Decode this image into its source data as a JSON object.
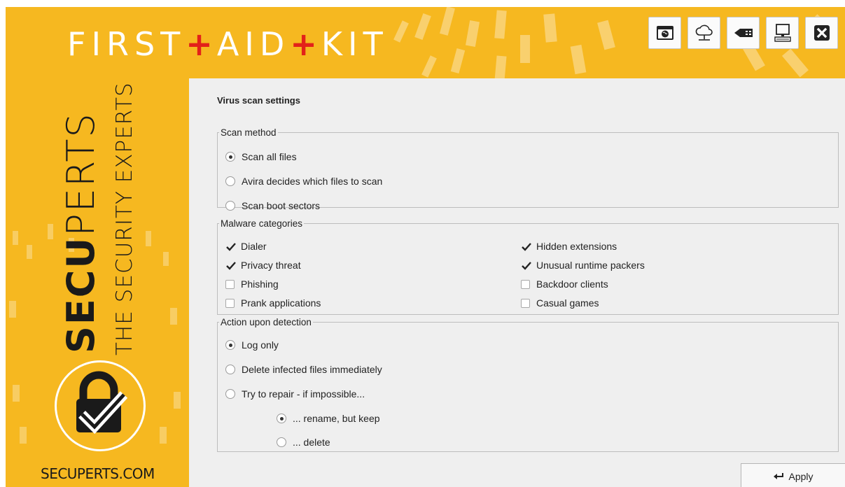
{
  "app": {
    "title_parts": [
      "FIRST",
      "AID",
      "KIT"
    ],
    "title_separator": "+"
  },
  "toolbar": {
    "buttons": [
      {
        "name": "browser-icon"
      },
      {
        "name": "cloud-network-icon"
      },
      {
        "name": "usb-icon"
      },
      {
        "name": "computer-icon"
      },
      {
        "name": "close-icon"
      }
    ]
  },
  "brand": {
    "name_bold": "SECU",
    "name_thin": "PERTS",
    "tagline": "THE SECURITY EXPERTS",
    "url": "SECUPERTS.COM"
  },
  "page": {
    "title": "Virus scan settings"
  },
  "scan_method": {
    "legend": "Scan method",
    "options": [
      {
        "label": "Scan all files",
        "selected": true
      },
      {
        "label": "Avira decides which files to scan",
        "selected": false
      },
      {
        "label": "Scan boot sectors",
        "selected": false
      }
    ]
  },
  "malware": {
    "legend": "Malware categories",
    "left": [
      {
        "label": "Dialer",
        "checked": true
      },
      {
        "label": "Privacy threat",
        "checked": true
      },
      {
        "label": "Phishing",
        "checked": false
      },
      {
        "label": "Prank applications",
        "checked": false
      }
    ],
    "right": [
      {
        "label": "Hidden extensions",
        "checked": true
      },
      {
        "label": "Unusual runtime packers",
        "checked": true
      },
      {
        "label": "Backdoor clients",
        "checked": false
      },
      {
        "label": "Casual games",
        "checked": false
      }
    ]
  },
  "action": {
    "legend": "Action upon detection",
    "options": [
      {
        "label": "Log only",
        "selected": true
      },
      {
        "label": "Delete infected files immediately",
        "selected": false
      },
      {
        "label": "Try to repair - if impossible...",
        "selected": false
      }
    ],
    "sub_options": [
      {
        "label": "... rename, but keep",
        "selected": true
      },
      {
        "label": "... delete",
        "selected": false
      }
    ]
  },
  "apply": {
    "label": "Apply"
  },
  "colors": {
    "brand_yellow": "#f6b820",
    "accent_red": "#e32119",
    "panel_bg": "#efefef"
  }
}
